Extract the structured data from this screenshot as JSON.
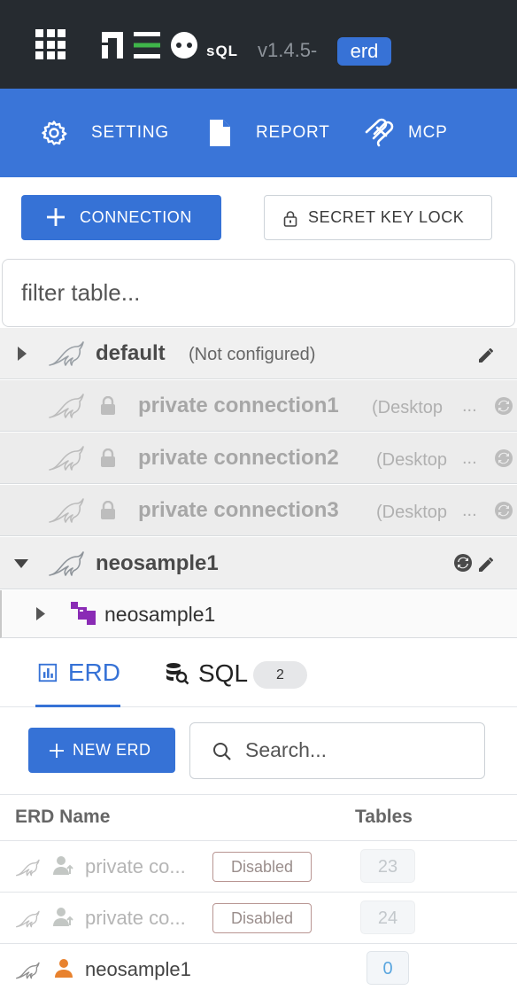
{
  "header": {
    "app_sql_label": "sQL",
    "version": "v1.4.5-",
    "version_badge": "erd"
  },
  "nav": {
    "setting": "SETTING",
    "report": "REPORT",
    "mcp": "MCP"
  },
  "actions": {
    "connection": "CONNECTION",
    "secret_key_lock": "SECRET KEY LOCK"
  },
  "filter": {
    "placeholder": "filter table..."
  },
  "tree": {
    "default": {
      "name": "default",
      "status": "(Not configured)"
    },
    "private": [
      {
        "name": "private connection1",
        "sub": "(Desktop",
        "more": "..."
      },
      {
        "name": "private connection2",
        "sub": "(Desktop",
        "more": "..."
      },
      {
        "name": "private connection3",
        "sub": "(Desktop",
        "more": "..."
      }
    ],
    "neosample": {
      "name": "neosample1",
      "schema": "neosample1"
    }
  },
  "tabs": {
    "erd": "ERD",
    "sql": "SQL",
    "sql_count": "2"
  },
  "erd_panel": {
    "new_erd": "NEW ERD",
    "search_placeholder": "Search...",
    "columns": {
      "name": "ERD Name",
      "tables": "Tables"
    },
    "rows": [
      {
        "name": "private co...",
        "badge": "Disabled",
        "tables": "23"
      },
      {
        "name": "private co...",
        "badge": "Disabled",
        "tables": "24"
      },
      {
        "name": "neosample1",
        "badge": "",
        "tables": "0"
      }
    ]
  },
  "colors": {
    "topbar": "#262b30",
    "nav": "#3a75d8",
    "accent": "#3672d6",
    "user_orange": "#e8822e",
    "schema_purple": "#8a2bb5"
  }
}
